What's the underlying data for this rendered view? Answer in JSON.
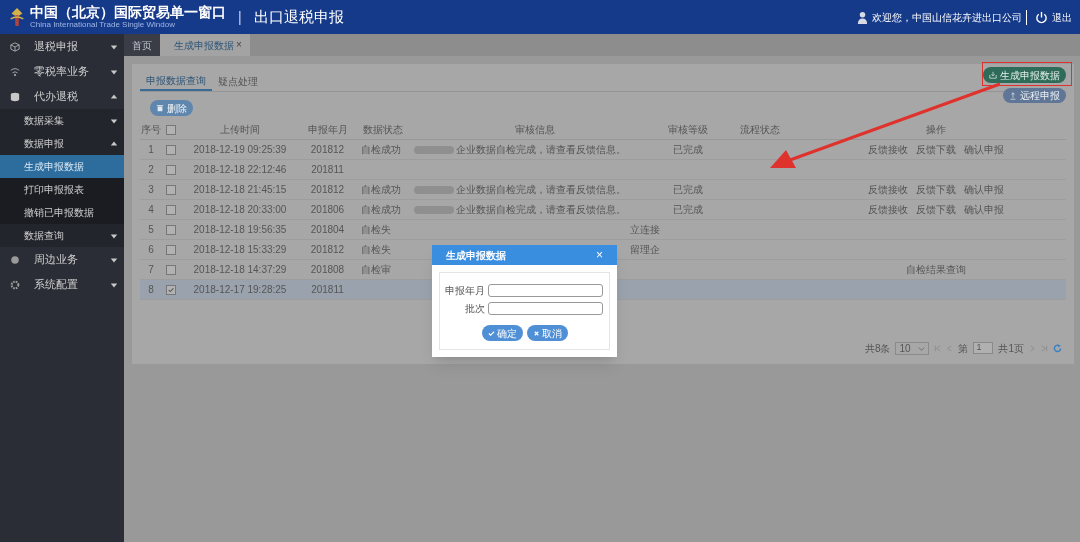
{
  "header": {
    "title": "中国（北京）国际贸易单一窗口",
    "subtitle": "China International Trade Single Window",
    "separator": "|",
    "module": "出口退税申报",
    "welcome": "欢迎您，中国山信花卉进出口公司",
    "logout": "退出"
  },
  "sidebar": {
    "items": [
      {
        "label": "退税申报",
        "expanded": false
      },
      {
        "label": "零税率业务",
        "expanded": false
      },
      {
        "label": "代办退税",
        "expanded": true,
        "children": [
          {
            "label": "数据采集",
            "expanded": false
          },
          {
            "label": "数据申报",
            "expanded": true,
            "children": [
              {
                "label": "生成申报数据",
                "selected": true
              },
              {
                "label": "打印申报报表",
                "selected": false
              },
              {
                "label": "撤销已申报数据",
                "selected": false
              }
            ]
          },
          {
            "label": "数据查询",
            "expanded": false
          }
        ]
      },
      {
        "label": "周边业务",
        "expanded": false
      },
      {
        "label": "系统配置",
        "expanded": false
      }
    ]
  },
  "tabs": [
    {
      "label": "首页",
      "selected": false
    },
    {
      "label": "生成申报数据",
      "selected": true,
      "close": "×"
    }
  ],
  "subtabs": [
    {
      "label": "申报数据查询",
      "selected": true
    },
    {
      "label": "疑点处理",
      "selected": false
    }
  ],
  "toolbar": {
    "delete": "删除",
    "generate": "生成申报数据",
    "remote": "远程申报"
  },
  "table": {
    "columns": [
      "序号",
      "上传时间",
      "申报年月",
      "数据状态",
      "审核信息",
      "审核等级",
      "流程状态",
      "操作"
    ],
    "all_checked": false,
    "rows": [
      {
        "no": "1",
        "checked": false,
        "selected": false,
        "time": "2018-12-19 09:25:39",
        "month": "201812",
        "status": "自检成功",
        "info": {
          "kind": "message",
          "redacted": true,
          "text": "企业数据自检完成，请查看反馈信息。"
        },
        "grade": "已完成",
        "actions": [
          "反馈接收",
          "反馈下载",
          "确认申报"
        ]
      },
      {
        "no": "2",
        "checked": false,
        "selected": false,
        "time": "2018-12-18 22:12:46",
        "month": "201811"
      },
      {
        "no": "3",
        "checked": false,
        "selected": false,
        "time": "2018-12-18 21:45:15",
        "month": "201812",
        "status": "自检成功",
        "info": {
          "kind": "message",
          "redacted": true,
          "text": "企业数据自检完成，请查看反馈信息。"
        },
        "grade": "已完成",
        "actions": [
          "反馈接收",
          "反馈下载",
          "确认申报"
        ]
      },
      {
        "no": "4",
        "checked": false,
        "selected": false,
        "time": "2018-12-18 20:33:00",
        "month": "201806",
        "status": "自检成功",
        "info": {
          "kind": "message",
          "redacted": true,
          "text": "企业数据自检完成，请查看反馈信息。"
        },
        "grade": "已完成",
        "actions": [
          "反馈接收",
          "反馈下载",
          "确认申报"
        ]
      },
      {
        "no": "5",
        "checked": false,
        "selected": false,
        "time": "2018-12-18 19:56:35",
        "month": "201804",
        "status": "自检失",
        "info": {
          "kind": "tail",
          "text": "立连接"
        }
      },
      {
        "no": "6",
        "checked": false,
        "selected": false,
        "time": "2018-12-18 15:33:29",
        "month": "201812",
        "status": "自检失",
        "info": {
          "kind": "tail",
          "text": "留理企"
        }
      },
      {
        "no": "7",
        "checked": false,
        "selected": false,
        "time": "2018-12-18 14:37:29",
        "month": "201808",
        "status": "自检审",
        "actions": [
          "自检结果查询"
        ]
      },
      {
        "no": "8",
        "checked": true,
        "selected": true,
        "time": "2018-12-17 19:28:25",
        "month": "201811"
      }
    ]
  },
  "pagination": {
    "total": "共8条",
    "page_size": "10",
    "page_label": "第",
    "page": "1",
    "pages": "共1页"
  },
  "dialog": {
    "title": "生成申报数据",
    "close": "×",
    "fields": [
      {
        "label": "申报年月"
      },
      {
        "label": "批次"
      }
    ],
    "buttons": [
      {
        "label": "确定",
        "kind": "ok"
      },
      {
        "label": "取消",
        "kind": "cancel"
      }
    ]
  }
}
